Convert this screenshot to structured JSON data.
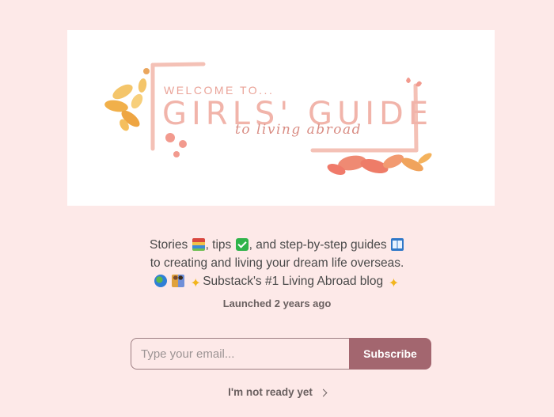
{
  "banner": {
    "welcome": "WELCOME TO...",
    "title": "GIRLS' GUIDE",
    "script": "to living abroad",
    "colors": {
      "frame": "#f4c1b6",
      "leaves_gold": "#f1b04a",
      "leaves_coral": "#ee7c68",
      "dots": "#f29a8e"
    }
  },
  "description": {
    "line1_a": "Stories",
    "line1_b": ", tips",
    "line1_c": ", and step-by-step guides",
    "line2": "to creating and living your dream life overseas.",
    "line3": "Substack's #1 Living Abroad blog",
    "icons": [
      "books-emoji",
      "check-mark-emoji",
      "open-book-emoji",
      "globe-emoji",
      "people-emoji",
      "sparkles-emoji",
      "sparkles-emoji"
    ]
  },
  "launched": "Launched 2 years ago",
  "form": {
    "email_placeholder": "Type your email...",
    "email_value": "",
    "subscribe_label": "Subscribe"
  },
  "not_ready": {
    "label": "I'm not ready yet",
    "icon": "chevron-right-icon"
  },
  "colors": {
    "background": "#fde9e8",
    "accent": "#a3666f"
  }
}
